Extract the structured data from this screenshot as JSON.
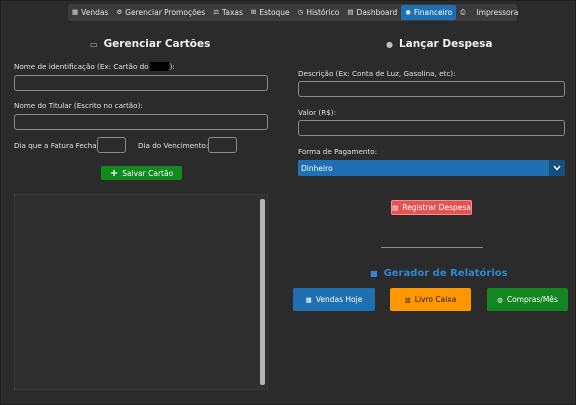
{
  "nav": {
    "items": [
      {
        "icon": "▦",
        "label": "Vendas"
      },
      {
        "icon": "⚙",
        "label": "Gerenciar Promoções"
      },
      {
        "icon": "⚖",
        "label": "Taxas"
      },
      {
        "icon": "⊞",
        "label": "Estoque"
      },
      {
        "icon": "◷",
        "label": "Histórico"
      },
      {
        "icon": "▤",
        "label": "Dashboard"
      },
      {
        "icon": "◉",
        "label": "Financeiro"
      },
      {
        "icon": "⎙",
        "label": "Impressora"
      }
    ],
    "active_label": "Financeiro"
  },
  "cards": {
    "title": "Gerenciar Cartões",
    "name_label_prefix": "Nome de identificação (Ex: Cartão do",
    "name_label_suffix": "):",
    "holder_label": "Nome do Titular (Escrito no cartão):",
    "closing_label": "Dia que a Fatura Fecha:",
    "due_label": "Dia do Vencimento:",
    "save_button": "Salvar Cartão"
  },
  "expense": {
    "title": "Lançar Despesa",
    "description_label": "Descrição (Ex: Conta de Luz, Gasolina, etc):",
    "value_label": "Valor (R$):",
    "payment_label": "Forma de Pagamento:",
    "payment_selected": "Dinheiro",
    "register_button": "Registrar Despesa"
  },
  "reports": {
    "title": "Gerador de Relatórios",
    "buttons": [
      "Vendas Hoje",
      "Livro Caixa",
      "Compras/Mês"
    ]
  },
  "colors": {
    "accent_blue": "#1f6fb3",
    "green": "#118a1d",
    "red": "#e25353",
    "orange": "#ff9800",
    "report_title": "#2f86d6"
  }
}
